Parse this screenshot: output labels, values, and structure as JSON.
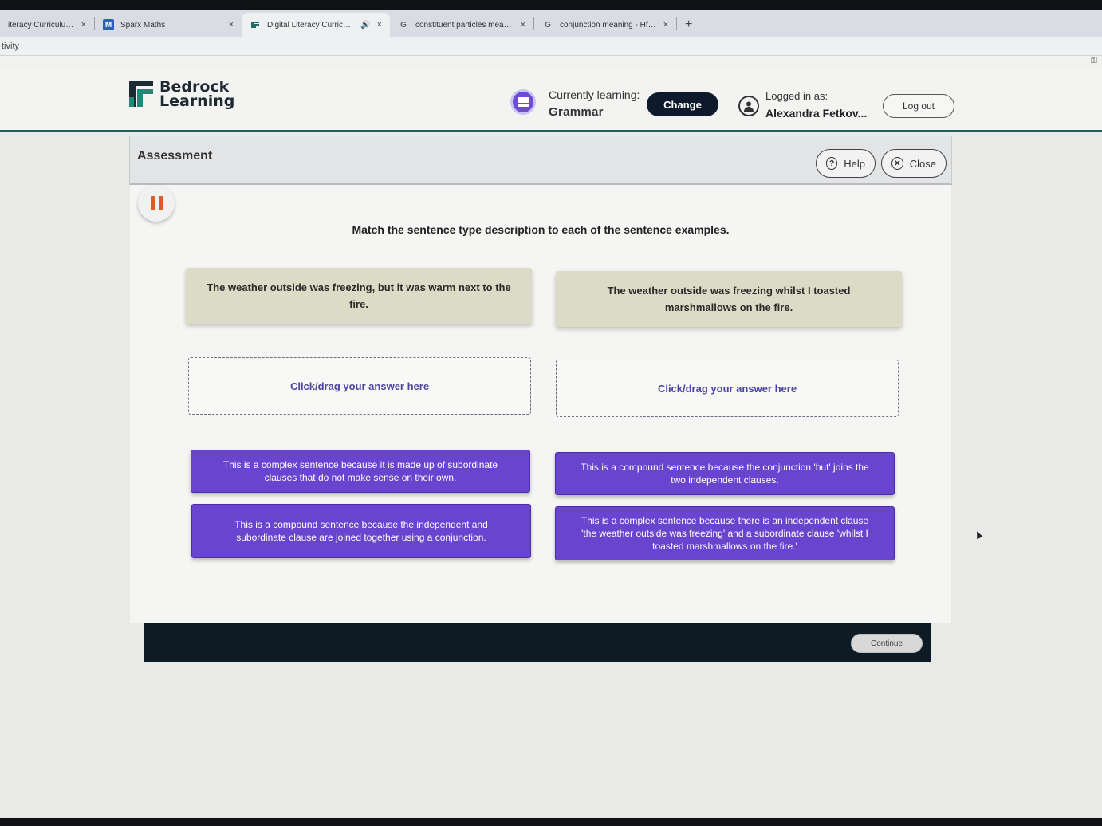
{
  "browser": {
    "tabs": [
      {
        "title": "iteracy Curriculum | B",
        "icon": "bedrock-favicon",
        "active": false
      },
      {
        "title": "Sparx Maths",
        "icon": "sparx-m-icon",
        "active": false
      },
      {
        "title": "Digital Literacy Curriculum",
        "icon": "bedrock-favicon",
        "active": true,
        "audio": true
      },
      {
        "title": "constituent particles meaning",
        "icon": "google-g-icon",
        "active": false
      },
      {
        "title": "conjunction meaning - Hfadal",
        "icon": "google-g-icon",
        "active": false
      }
    ],
    "tab_close_glyph": "×",
    "new_tab_glyph": "+",
    "address_fragment": "tivity"
  },
  "header": {
    "logo_line1": "Bedrock",
    "logo_line2": "Learning",
    "currently_label": "Currently learning:",
    "subject": "Grammar",
    "change_label": "Change",
    "logged_in_label": "Logged in as:",
    "user_name": "Alexandra Fetkov...",
    "logout_label": "Log out"
  },
  "assessment": {
    "title": "Assessment",
    "help_label": "Help",
    "close_label": "Close",
    "instruction": "Match the sentence type description to each of the sentence examples.",
    "examples": [
      "The weather outside was freezing, but it was warm next to the fire.",
      "The weather outside was freezing whilst I toasted marshmallows on the fire."
    ],
    "drop_placeholder": "Click/drag your answer here",
    "answers": [
      "This is a complex sentence because it is made up of subordinate clauses that do not make sense on their own.",
      "This is a compound sentence because the conjunction 'but' joins the two independent clauses.",
      "This is a compound sentence because the independent and subordinate clause are joined together using a conjunction.",
      "This is a complex sentence because there is an independent clause 'the weather outside was freezing' and a subordinate clause 'whilst I toasted marshmallows on the fire.'"
    ],
    "continue_label": "Continue"
  },
  "colors": {
    "brand_teal": "#1f5e57",
    "answer_purple": "#6844cf",
    "example_beige": "#dcdbc6",
    "footer_dark": "#0e1a24",
    "pause_orange": "#e05a25"
  }
}
